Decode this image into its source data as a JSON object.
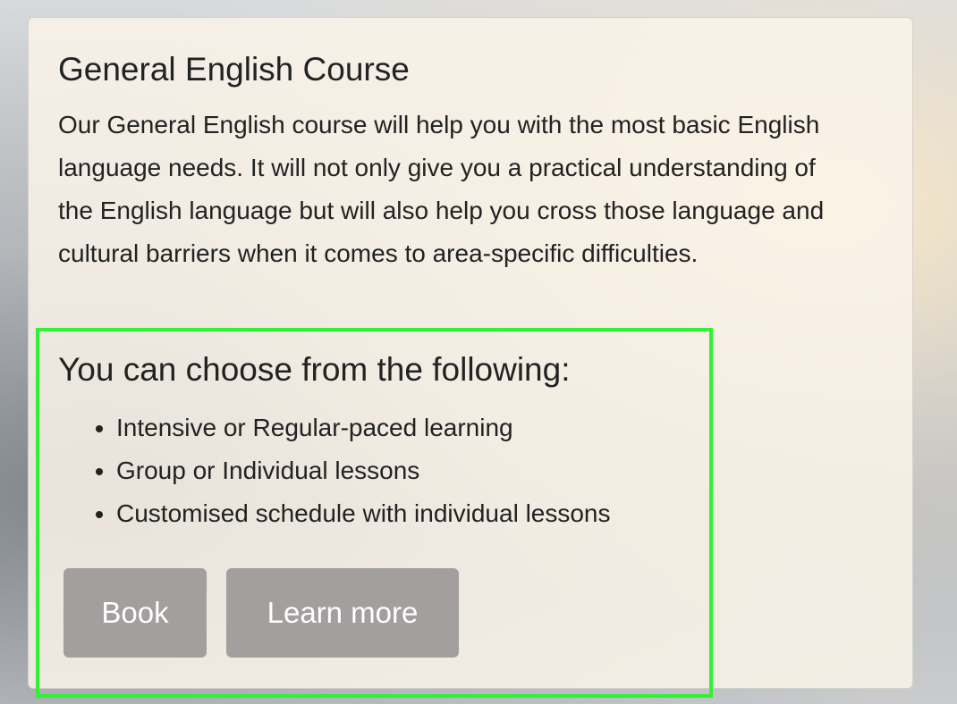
{
  "course": {
    "title": "General English Course",
    "description": "Our General English course will help you with the most basic English language needs. It will not only give you a practical understanding of the English language but will also help you cross those language and cultural barriers when it comes to area-specific difficulties."
  },
  "choices": {
    "heading": "You can choose from the following:",
    "items": [
      "Intensive or Regular-paced learning",
      "Group or Individual lessons",
      "Customised schedule with individual lessons"
    ]
  },
  "buttons": {
    "book_label": "Book",
    "learn_more_label": "Learn more"
  },
  "colors": {
    "button_bg": "#a29f9e",
    "highlight_border": "#2ef232",
    "card_bg": "#faf3e9"
  }
}
